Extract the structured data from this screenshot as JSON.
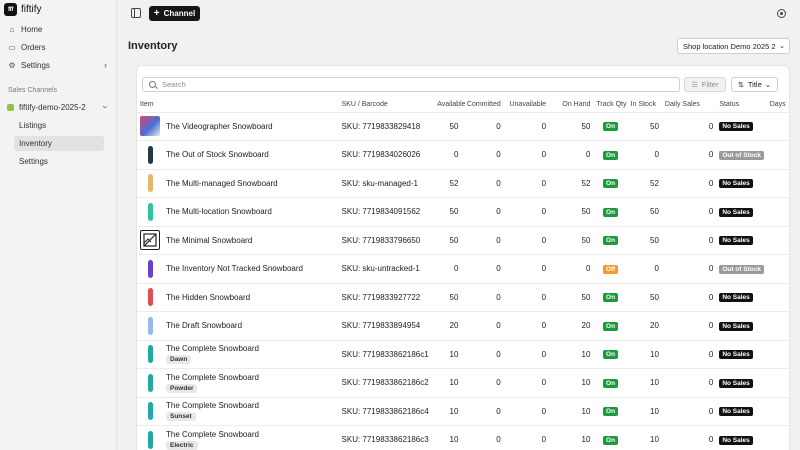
{
  "app": {
    "name": "fiftify",
    "logo_text": "fff"
  },
  "sidebar": {
    "nav": [
      {
        "label": "Home",
        "icon": "home-icon"
      },
      {
        "label": "Orders",
        "icon": "orders-icon"
      },
      {
        "label": "Settings",
        "icon": "gear-icon"
      }
    ],
    "section_label": "Sales Channels",
    "channel": {
      "label": "fiftify-demo-2025-2"
    },
    "sub_items": [
      {
        "label": "Listings"
      },
      {
        "label": "Inventory",
        "active": true
      },
      {
        "label": "Settings"
      }
    ]
  },
  "topbar": {
    "channel_button": "Channel"
  },
  "page": {
    "title": "Inventory",
    "location_select": "Shop location Demo 2025 2"
  },
  "toolbar": {
    "search_placeholder": "Search",
    "filter_label": "Filter",
    "sort_label": "Title"
  },
  "table": {
    "columns": [
      "Item",
      "SKU / Barcode",
      "Available",
      "Committed",
      "Unavailable",
      "On Hand",
      "Track Qty",
      "In Stock",
      "Daily Sales",
      "Status",
      "Days"
    ],
    "rows": [
      {
        "name": "The Videographer Snowboard",
        "variant": "",
        "sku": "SKU: 7719833829418",
        "available": "50",
        "committed": "0",
        "unavailable": "0",
        "on_hand": "50",
        "track": "On",
        "in_stock": "50",
        "daily": "0",
        "status": "No Sales",
        "thumb": "photo"
      },
      {
        "name": "The Out of Stock Snowboard",
        "variant": "",
        "sku": "SKU: 7719834026026",
        "available": "0",
        "committed": "0",
        "unavailable": "0",
        "on_hand": "0",
        "track": "On",
        "in_stock": "0",
        "daily": "0",
        "status": "Out of Stock",
        "thumb": "#1f3b45"
      },
      {
        "name": "The Multi-managed Snowboard",
        "variant": "",
        "sku": "SKU: sku-managed-1",
        "available": "52",
        "committed": "0",
        "unavailable": "0",
        "on_hand": "52",
        "track": "On",
        "in_stock": "52",
        "daily": "0",
        "status": "No Sales",
        "thumb": "#e7b66d"
      },
      {
        "name": "The Multi-location Snowboard",
        "variant": "",
        "sku": "SKU: 7719834091562",
        "available": "50",
        "committed": "0",
        "unavailable": "0",
        "on_hand": "50",
        "track": "On",
        "in_stock": "50",
        "daily": "0",
        "status": "No Sales",
        "thumb": "#2fc3a0"
      },
      {
        "name": "The Minimal Snowboard",
        "variant": "",
        "sku": "SKU: 7719833796650",
        "available": "50",
        "committed": "0",
        "unavailable": "0",
        "on_hand": "50",
        "track": "On",
        "in_stock": "50",
        "daily": "0",
        "status": "No Sales",
        "thumb": "placeholder"
      },
      {
        "name": "The Inventory Not Tracked Snowboard",
        "variant": "",
        "sku": "SKU: sku-untracked-1",
        "available": "0",
        "committed": "0",
        "unavailable": "0",
        "on_hand": "0",
        "track": "Off",
        "in_stock": "0",
        "daily": "0",
        "status": "Out of Stock",
        "thumb": "#6a3fd1"
      },
      {
        "name": "The Hidden Snowboard",
        "variant": "",
        "sku": "SKU: 7719833927722",
        "available": "50",
        "committed": "0",
        "unavailable": "0",
        "on_hand": "50",
        "track": "On",
        "in_stock": "50",
        "daily": "0",
        "status": "No Sales",
        "thumb": "#e24c52"
      },
      {
        "name": "The Draft Snowboard",
        "variant": "",
        "sku": "SKU: 7719833894954",
        "available": "20",
        "committed": "0",
        "unavailable": "0",
        "on_hand": "20",
        "track": "On",
        "in_stock": "20",
        "daily": "0",
        "status": "No Sales",
        "thumb": "#9ab7e8"
      },
      {
        "name": "The Complete Snowboard",
        "variant": "Dawn",
        "sku": "SKU: 7719833862186c1",
        "available": "10",
        "committed": "0",
        "unavailable": "0",
        "on_hand": "10",
        "track": "On",
        "in_stock": "10",
        "daily": "0",
        "status": "No Sales",
        "thumb": "#22a9a5"
      },
      {
        "name": "The Complete Snowboard",
        "variant": "Powder",
        "sku": "SKU: 7719833862186c2",
        "available": "10",
        "committed": "0",
        "unavailable": "0",
        "on_hand": "10",
        "track": "On",
        "in_stock": "10",
        "daily": "0",
        "status": "No Sales",
        "thumb": "#22a9a5"
      },
      {
        "name": "The Complete Snowboard",
        "variant": "Sunset",
        "sku": "SKU: 7719833862186c4",
        "available": "10",
        "committed": "0",
        "unavailable": "0",
        "on_hand": "10",
        "track": "On",
        "in_stock": "10",
        "daily": "0",
        "status": "No Sales",
        "thumb": "#22a9a5"
      },
      {
        "name": "The Complete Snowboard",
        "variant": "Electric",
        "sku": "SKU: 7719833862186c3",
        "available": "10",
        "committed": "0",
        "unavailable": "0",
        "on_hand": "10",
        "track": "On",
        "in_stock": "10",
        "daily": "0",
        "status": "No Sales",
        "thumb": "#22a9a5"
      }
    ]
  },
  "colors": {
    "track_on": "#1a9b3c",
    "track_off": "#f49a2a",
    "no_sales": "#111111",
    "out_of_stock": "#9a9a9a",
    "channel_dot": "#95bf47"
  }
}
